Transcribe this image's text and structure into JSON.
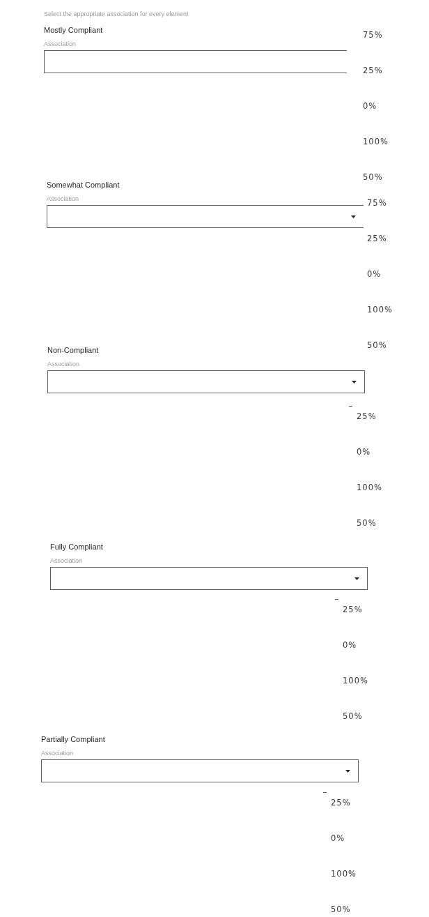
{
  "instruction": "Select the appropriate association for every element",
  "elements": [
    {
      "title": "Mostly Compliant",
      "field_label": "Association",
      "options": [
        {
          "label": "75%",
          "selected": false
        },
        {
          "label": "25%",
          "selected": false
        },
        {
          "label": "0%",
          "selected": false
        },
        {
          "label": "100%",
          "selected": false
        },
        {
          "label": "50%",
          "selected": false
        }
      ]
    },
    {
      "title": "Somewhat Compliant",
      "field_label": "Association",
      "options": [
        {
          "label": "75%",
          "selected": false
        },
        {
          "label": "25%",
          "selected": false
        },
        {
          "label": "0%",
          "selected": false
        },
        {
          "label": "100%",
          "selected": false
        },
        {
          "label": "50%",
          "selected": false
        }
      ]
    },
    {
      "title": "Non-Compliant",
      "field_label": "Association",
      "cut_off_option": true,
      "options": [
        {
          "label": "25%",
          "selected": false
        },
        {
          "label": "0%",
          "selected": false
        },
        {
          "label": "100%",
          "selected": false
        },
        {
          "label": "50%",
          "selected": false
        }
      ]
    },
    {
      "title": "Fully Compliant",
      "field_label": "Association",
      "cut_off_option": true,
      "options": [
        {
          "label": "25%",
          "selected": false
        },
        {
          "label": "0%",
          "selected": false
        },
        {
          "label": "100%",
          "selected": false
        },
        {
          "label": "50%",
          "selected": false
        }
      ]
    },
    {
      "title": "Partially Compliant",
      "field_label": "Association",
      "cut_off_option": true,
      "options": [
        {
          "label": "25%",
          "selected": false
        },
        {
          "label": "0%",
          "selected": false
        },
        {
          "label": "100%",
          "selected": false
        },
        {
          "label": "50%",
          "selected": false
        }
      ]
    }
  ]
}
